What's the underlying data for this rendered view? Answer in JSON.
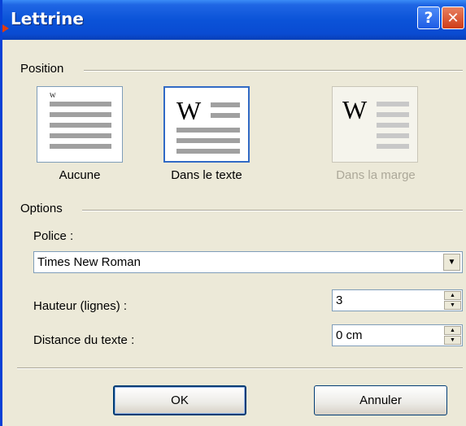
{
  "window": {
    "title": "Lettrine",
    "help_glyph": "?",
    "close_glyph": "✕"
  },
  "position": {
    "label": "Position",
    "tiles": [
      {
        "label": "Aucune",
        "state": "normal",
        "glyph": "W"
      },
      {
        "label": "Dans le texte",
        "state": "selected",
        "glyph": "W"
      },
      {
        "label": "Dans la marge",
        "state": "disabled",
        "glyph": "W"
      }
    ]
  },
  "options": {
    "label": "Options",
    "font_label": "Police :",
    "font_value": "Times New Roman",
    "height_label": "Hauteur (lignes) :",
    "height_value": "3",
    "distance_label": "Distance du texte :",
    "distance_value": "0 cm"
  },
  "buttons": {
    "ok": "OK",
    "cancel": "Annuler"
  },
  "colors": {
    "titlebar": "#0A4BD2",
    "selection": "#316AC5",
    "face": "#ECE9D8"
  }
}
